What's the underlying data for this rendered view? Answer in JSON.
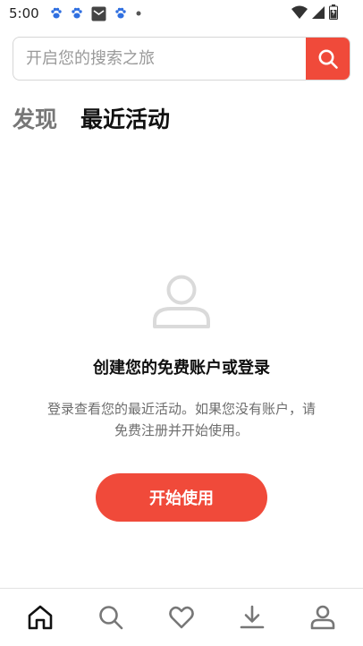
{
  "status_bar": {
    "time": "5:00",
    "icons_left": [
      "baidu-paw-icon",
      "baidu-paw-icon",
      "mail-icon",
      "baidu-paw-icon",
      "dot-icon"
    ],
    "icons_right": [
      "wifi-icon",
      "cellular-signal-icon",
      "battery-icon"
    ]
  },
  "search": {
    "placeholder": "开启您的搜索之旅",
    "value": "",
    "button_icon": "search-icon"
  },
  "tabs": [
    {
      "label": "发现",
      "active": false
    },
    {
      "label": "最近活动",
      "active": true
    }
  ],
  "empty_state": {
    "icon": "user-icon",
    "title": "创建您的免费账户或登录",
    "description": "登录查看您的最近活动。如果您没有账户，请免费注册并开始使用。",
    "button_label": "开始使用"
  },
  "bottom_nav": {
    "items": [
      "home-icon",
      "search-icon",
      "heart-icon",
      "download-icon",
      "profile-icon"
    ],
    "active": "home-icon"
  },
  "colors": {
    "accent": "#f04a3a",
    "text_primary": "#111111",
    "text_secondary": "#6d6d6d",
    "icon_inactive": "#777777"
  }
}
